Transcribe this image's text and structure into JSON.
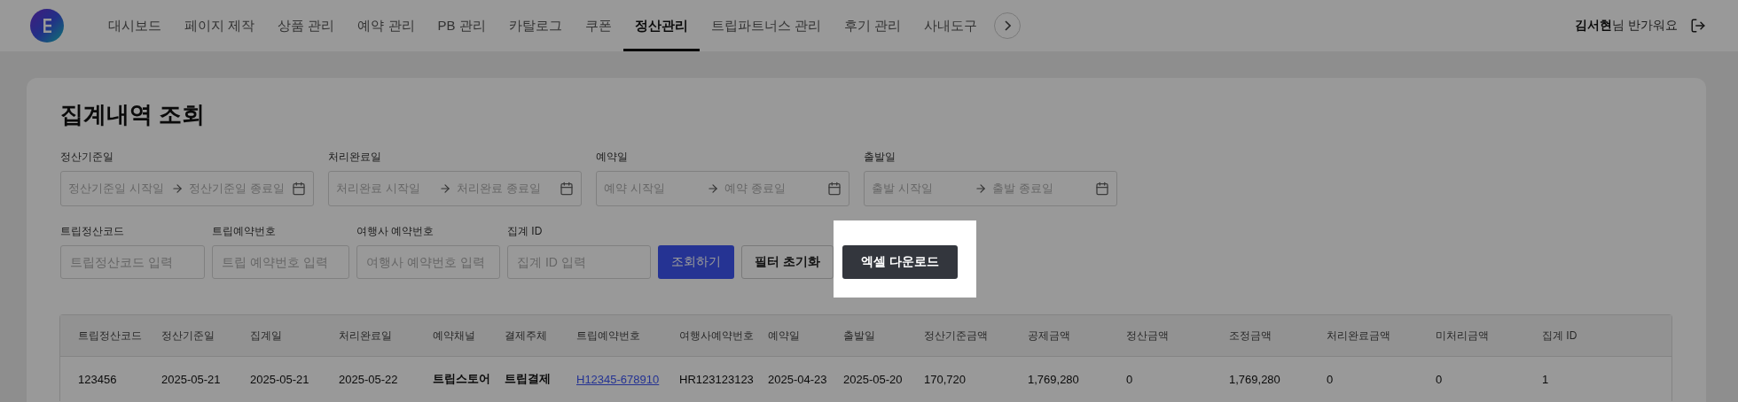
{
  "nav": {
    "items": [
      {
        "label": "대시보드",
        "selected": false
      },
      {
        "label": "페이지 제작",
        "selected": false
      },
      {
        "label": "상품 관리",
        "selected": false
      },
      {
        "label": "예약 관리",
        "selected": false
      },
      {
        "label": "PB 관리",
        "selected": false
      },
      {
        "label": "카탈로그",
        "selected": false
      },
      {
        "label": "쿠폰",
        "selected": false
      },
      {
        "label": "정산관리",
        "selected": true
      },
      {
        "label": "트립파트너스 관리",
        "selected": false
      },
      {
        "label": "후기 관리",
        "selected": false
      },
      {
        "label": "사내도구",
        "selected": false
      }
    ],
    "user_name": "김서현",
    "greeting": "님 반가워요"
  },
  "page_title": "집계내역 조회",
  "date_filters": [
    {
      "label": "정산기준일",
      "start_placeholder": "정산기준일 시작일",
      "end_placeholder": "정산기준일 종료일"
    },
    {
      "label": "처리완료일",
      "start_placeholder": "처리완료 시작일",
      "end_placeholder": "처리완료 종료일"
    },
    {
      "label": "예약일",
      "start_placeholder": "예약 시작일",
      "end_placeholder": "예약 종료일"
    },
    {
      "label": "출발일",
      "start_placeholder": "출발 시작일",
      "end_placeholder": "출발 종료일"
    }
  ],
  "text_filters": [
    {
      "label": "트립정산코드",
      "placeholder": "트립정산코드 입력"
    },
    {
      "label": "트립예약번호",
      "placeholder": "트립 예약번호 입력"
    },
    {
      "label": "여행사 예약번호",
      "placeholder": "여행사 예약번호 입력"
    },
    {
      "label": "집계 ID",
      "placeholder": "집계 ID 입력"
    }
  ],
  "buttons": [
    {
      "label": "조회하기",
      "kind": "primary",
      "highlighted": false
    },
    {
      "label": "필터 초기화",
      "kind": "secondary",
      "highlighted": false
    },
    {
      "label": "엑셀 다운로드",
      "kind": "dark",
      "highlighted": true
    }
  ],
  "table": {
    "columns": [
      {
        "label": "트립정산코드",
        "kind": "text"
      },
      {
        "label": "정산기준일",
        "kind": "text"
      },
      {
        "label": "집계일",
        "kind": "text"
      },
      {
        "label": "처리완료일",
        "kind": "text"
      },
      {
        "label": "예약채널",
        "kind": "bold"
      },
      {
        "label": "결제주체",
        "kind": "bold"
      },
      {
        "label": "트립예약번호",
        "kind": "link"
      },
      {
        "label": "여행사예약번호",
        "kind": "text"
      },
      {
        "label": "예약일",
        "kind": "text"
      },
      {
        "label": "출발일",
        "kind": "text"
      },
      {
        "label": "정산기준금액",
        "kind": "text"
      },
      {
        "label": "공제금액",
        "kind": "text"
      },
      {
        "label": "정산금액",
        "kind": "text"
      },
      {
        "label": "조정금액",
        "kind": "text"
      },
      {
        "label": "처리완료금액",
        "kind": "text"
      },
      {
        "label": "미처리금액",
        "kind": "text"
      },
      {
        "label": "집계 ID",
        "kind": "text"
      }
    ],
    "rows": [
      {
        "cells": [
          "123456",
          "2025-05-21",
          "2025-05-21",
          "2025-05-22",
          "트립스토어",
          "트립결제",
          "H12345-678910",
          "HR123123123",
          "2025-04-23",
          "2025-05-20",
          "170,720",
          "1,769,280",
          "0",
          "1,769,280",
          "0",
          "0",
          "1"
        ]
      }
    ]
  }
}
